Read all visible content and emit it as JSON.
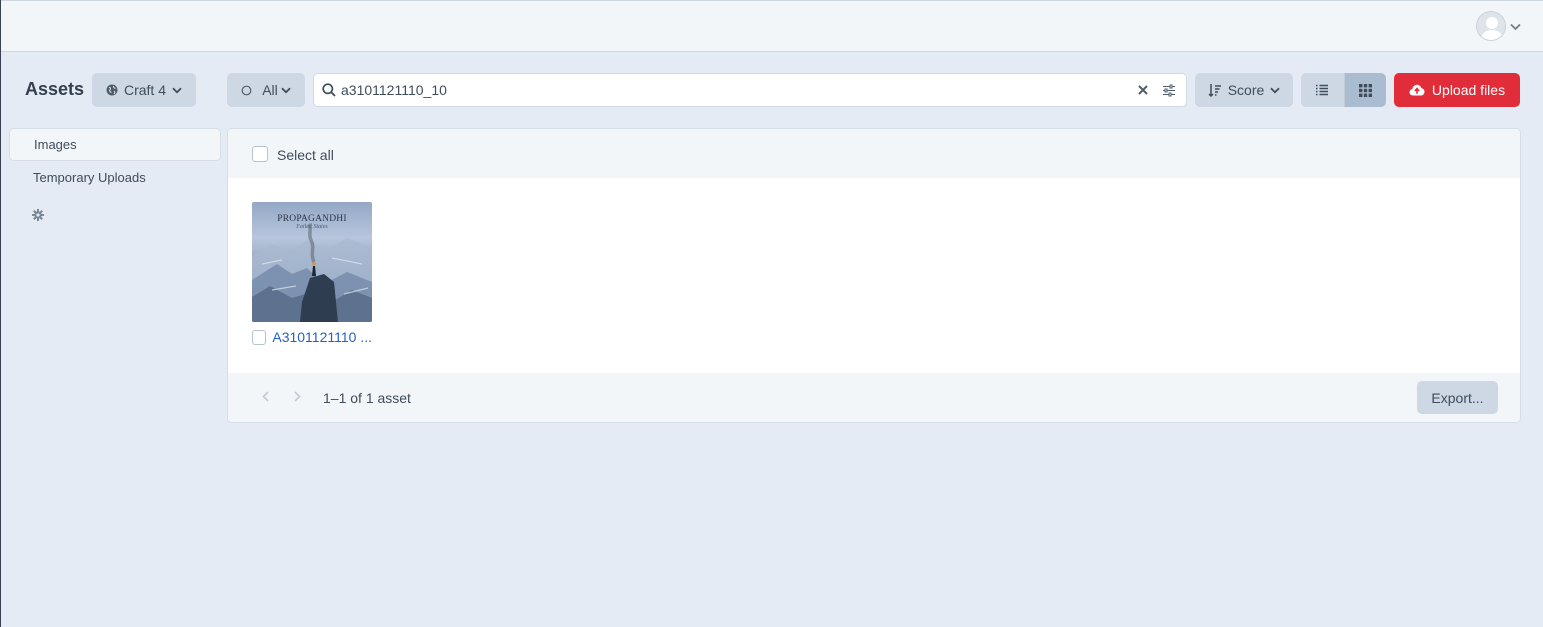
{
  "account": {
    "menu_icon": "chevron-down-icon"
  },
  "header": {
    "title": "Assets",
    "site_label": "Craft 4",
    "source_label": "All",
    "search": {
      "value": "a3101121110_10",
      "placeholder": "Search"
    },
    "sort_label": "Score",
    "upload_label": "Upload files"
  },
  "sidebar": {
    "items": [
      {
        "label": "Images",
        "selected": true
      },
      {
        "label": "Temporary Uploads",
        "selected": false
      }
    ]
  },
  "listing": {
    "select_all_label": "Select all",
    "assets": [
      {
        "title": "A3101121110 ...",
        "thumb_title": "PROPAGANDHI",
        "thumb_subtitle": "Failed States"
      }
    ],
    "pagination_text": "1–1 of 1 asset",
    "export_label": "Export..."
  },
  "colors": {
    "accent": "#e12d39",
    "link": "#2661c8",
    "background": "#e4ebf4"
  }
}
